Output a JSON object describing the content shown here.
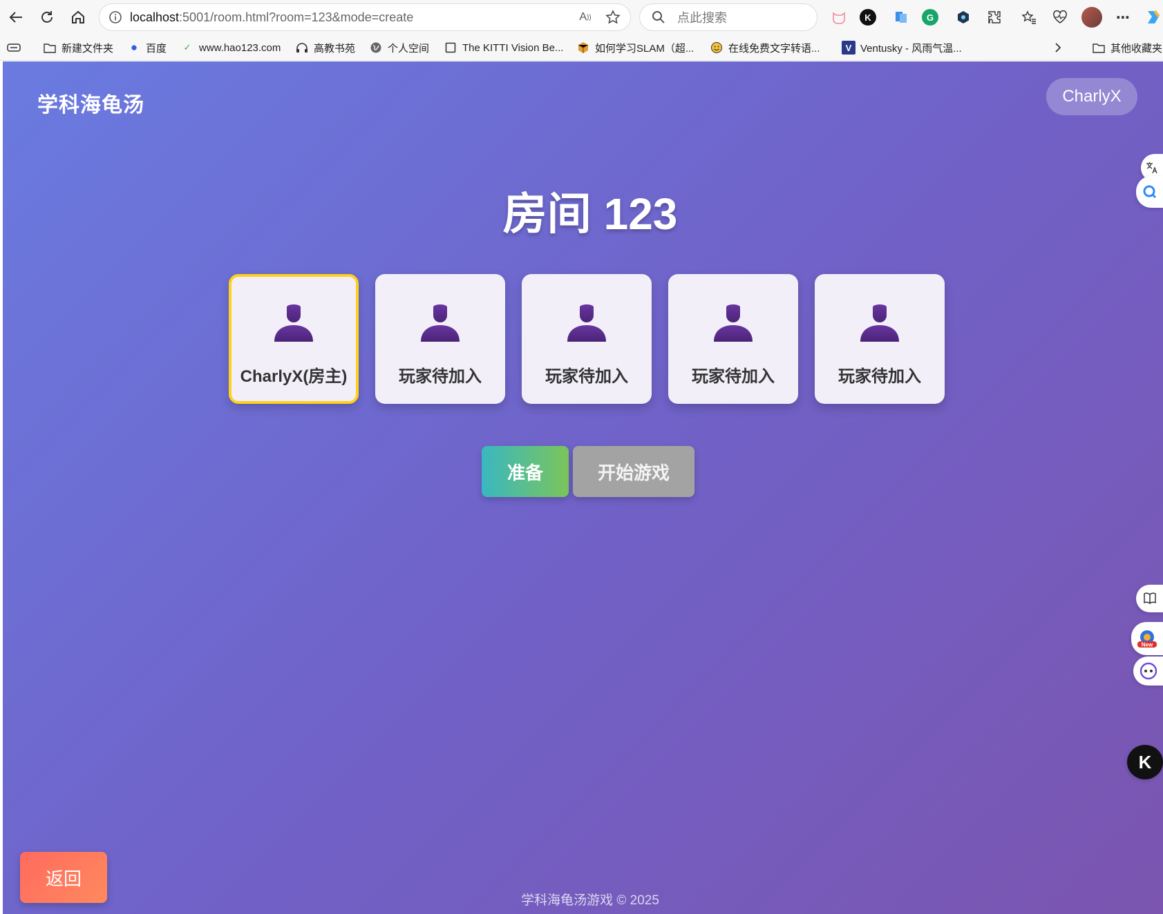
{
  "browser": {
    "url_host": "localhost",
    "url_rest": ":5001/room.html?room=123&mode=create",
    "search_placeholder": "点此搜索",
    "bookmarks": [
      {
        "label": "新建文件夹",
        "icon": "folder-icon"
      },
      {
        "label": "百度",
        "icon": "baidu-icon"
      },
      {
        "label": "www.hao123.com",
        "icon": "hao123-icon"
      },
      {
        "label": "高教书苑",
        "icon": "headphones-icon"
      },
      {
        "label": "个人空间",
        "icon": "globe-icon"
      },
      {
        "label": "The KITTI Vision Be...",
        "icon": "page-icon"
      },
      {
        "label": "如何学习SLAM（超...",
        "icon": "box-icon"
      },
      {
        "label": "在线免费文字转语...",
        "icon": "emoji-icon"
      },
      {
        "label": "Ventusky - 风雨气温...",
        "icon": "ventusky-icon"
      },
      {
        "label": "其他收藏夹",
        "icon": "folder-icon"
      }
    ]
  },
  "app": {
    "brand": "学科海龟汤",
    "username": "CharlyX",
    "room_label": "房间",
    "room_number": "123",
    "slots": [
      {
        "name": "CharlyX(房主)",
        "is_host": true
      },
      {
        "name": "玩家待加入",
        "is_host": false
      },
      {
        "name": "玩家待加入",
        "is_host": false
      },
      {
        "name": "玩家待加入",
        "is_host": false
      },
      {
        "name": "玩家待加入",
        "is_host": false
      }
    ],
    "ready_label": "准备",
    "start_label": "开始游戏",
    "back_label": "返回",
    "footer": "学科海龟汤游戏 © 2025"
  },
  "colors": {
    "host_border": "#ffd11a",
    "avatar": "#5b2a86",
    "back_button": "#ff6f5e",
    "start_disabled": "#a3a3a3"
  }
}
